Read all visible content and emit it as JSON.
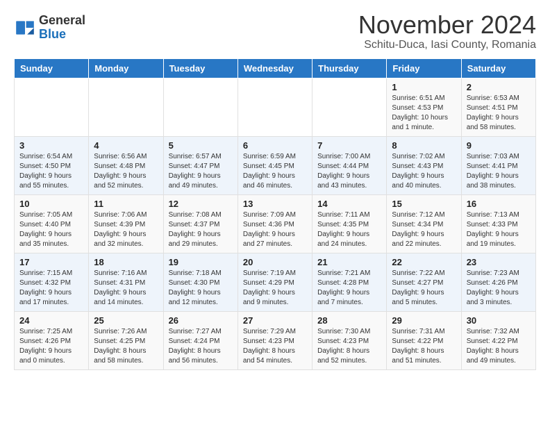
{
  "logo": {
    "general": "General",
    "blue": "Blue"
  },
  "header": {
    "month_year": "November 2024",
    "location": "Schitu-Duca, Iasi County, Romania"
  },
  "weekdays": [
    "Sunday",
    "Monday",
    "Tuesday",
    "Wednesday",
    "Thursday",
    "Friday",
    "Saturday"
  ],
  "weeks": [
    [
      {
        "day": "",
        "info": ""
      },
      {
        "day": "",
        "info": ""
      },
      {
        "day": "",
        "info": ""
      },
      {
        "day": "",
        "info": ""
      },
      {
        "day": "",
        "info": ""
      },
      {
        "day": "1",
        "info": "Sunrise: 6:51 AM\nSunset: 4:53 PM\nDaylight: 10 hours\nand 1 minute."
      },
      {
        "day": "2",
        "info": "Sunrise: 6:53 AM\nSunset: 4:51 PM\nDaylight: 9 hours\nand 58 minutes."
      }
    ],
    [
      {
        "day": "3",
        "info": "Sunrise: 6:54 AM\nSunset: 4:50 PM\nDaylight: 9 hours\nand 55 minutes."
      },
      {
        "day": "4",
        "info": "Sunrise: 6:56 AM\nSunset: 4:48 PM\nDaylight: 9 hours\nand 52 minutes."
      },
      {
        "day": "5",
        "info": "Sunrise: 6:57 AM\nSunset: 4:47 PM\nDaylight: 9 hours\nand 49 minutes."
      },
      {
        "day": "6",
        "info": "Sunrise: 6:59 AM\nSunset: 4:45 PM\nDaylight: 9 hours\nand 46 minutes."
      },
      {
        "day": "7",
        "info": "Sunrise: 7:00 AM\nSunset: 4:44 PM\nDaylight: 9 hours\nand 43 minutes."
      },
      {
        "day": "8",
        "info": "Sunrise: 7:02 AM\nSunset: 4:43 PM\nDaylight: 9 hours\nand 40 minutes."
      },
      {
        "day": "9",
        "info": "Sunrise: 7:03 AM\nSunset: 4:41 PM\nDaylight: 9 hours\nand 38 minutes."
      }
    ],
    [
      {
        "day": "10",
        "info": "Sunrise: 7:05 AM\nSunset: 4:40 PM\nDaylight: 9 hours\nand 35 minutes."
      },
      {
        "day": "11",
        "info": "Sunrise: 7:06 AM\nSunset: 4:39 PM\nDaylight: 9 hours\nand 32 minutes."
      },
      {
        "day": "12",
        "info": "Sunrise: 7:08 AM\nSunset: 4:37 PM\nDaylight: 9 hours\nand 29 minutes."
      },
      {
        "day": "13",
        "info": "Sunrise: 7:09 AM\nSunset: 4:36 PM\nDaylight: 9 hours\nand 27 minutes."
      },
      {
        "day": "14",
        "info": "Sunrise: 7:11 AM\nSunset: 4:35 PM\nDaylight: 9 hours\nand 24 minutes."
      },
      {
        "day": "15",
        "info": "Sunrise: 7:12 AM\nSunset: 4:34 PM\nDaylight: 9 hours\nand 22 minutes."
      },
      {
        "day": "16",
        "info": "Sunrise: 7:13 AM\nSunset: 4:33 PM\nDaylight: 9 hours\nand 19 minutes."
      }
    ],
    [
      {
        "day": "17",
        "info": "Sunrise: 7:15 AM\nSunset: 4:32 PM\nDaylight: 9 hours\nand 17 minutes."
      },
      {
        "day": "18",
        "info": "Sunrise: 7:16 AM\nSunset: 4:31 PM\nDaylight: 9 hours\nand 14 minutes."
      },
      {
        "day": "19",
        "info": "Sunrise: 7:18 AM\nSunset: 4:30 PM\nDaylight: 9 hours\nand 12 minutes."
      },
      {
        "day": "20",
        "info": "Sunrise: 7:19 AM\nSunset: 4:29 PM\nDaylight: 9 hours\nand 9 minutes."
      },
      {
        "day": "21",
        "info": "Sunrise: 7:21 AM\nSunset: 4:28 PM\nDaylight: 9 hours\nand 7 minutes."
      },
      {
        "day": "22",
        "info": "Sunrise: 7:22 AM\nSunset: 4:27 PM\nDaylight: 9 hours\nand 5 minutes."
      },
      {
        "day": "23",
        "info": "Sunrise: 7:23 AM\nSunset: 4:26 PM\nDaylight: 9 hours\nand 3 minutes."
      }
    ],
    [
      {
        "day": "24",
        "info": "Sunrise: 7:25 AM\nSunset: 4:26 PM\nDaylight: 9 hours\nand 0 minutes."
      },
      {
        "day": "25",
        "info": "Sunrise: 7:26 AM\nSunset: 4:25 PM\nDaylight: 8 hours\nand 58 minutes."
      },
      {
        "day": "26",
        "info": "Sunrise: 7:27 AM\nSunset: 4:24 PM\nDaylight: 8 hours\nand 56 minutes."
      },
      {
        "day": "27",
        "info": "Sunrise: 7:29 AM\nSunset: 4:23 PM\nDaylight: 8 hours\nand 54 minutes."
      },
      {
        "day": "28",
        "info": "Sunrise: 7:30 AM\nSunset: 4:23 PM\nDaylight: 8 hours\nand 52 minutes."
      },
      {
        "day": "29",
        "info": "Sunrise: 7:31 AM\nSunset: 4:22 PM\nDaylight: 8 hours\nand 51 minutes."
      },
      {
        "day": "30",
        "info": "Sunrise: 7:32 AM\nSunset: 4:22 PM\nDaylight: 8 hours\nand 49 minutes."
      }
    ]
  ]
}
